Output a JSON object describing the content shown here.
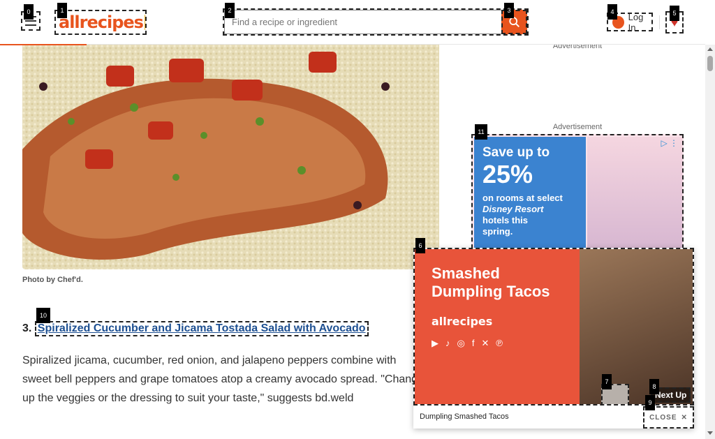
{
  "header": {
    "logo_text": "allrecipes",
    "search_placeholder": "Find a recipe or ingredient",
    "login_label": "Log In",
    "advertisement_top": "Advertisement",
    "scroll_progress_fraction": 0.12
  },
  "main": {
    "photo_caption": "Photo by Chef'd.",
    "recipe_number": "3.",
    "recipe_title": "Spiralized Cucumber and Jicama Tostada Salad with Avocado",
    "recipe_description": "Spiralized jicama, cucumber, red onion, and jalapeno peppers combine with sweet bell peppers and grape tomatoes atop a creamy avocado spread. \"Change up the veggies or the dressing to suit your taste,\" suggests bd.weld"
  },
  "rail": {
    "advertisement_label": "Advertisement",
    "ad": {
      "line1": "Save up to",
      "percent": "25%",
      "line2": "on rooms at select",
      "line3": "Disney Resort",
      "line4": "hotels this",
      "line5": "spring."
    }
  },
  "video": {
    "title_line1": "Smashed",
    "title_line2": "Dumpling Tacos",
    "brand": "allrecipes",
    "caption": "Dumpling Smashed Tacos",
    "next_up": "Next Up",
    "close_label": "CLOSE",
    "social_icons": [
      "youtube-icon",
      "tiktok-icon",
      "instagram-icon",
      "facebook-icon",
      "x-icon",
      "pinterest-icon"
    ]
  },
  "badges": [
    "0",
    "1",
    "2",
    "3",
    "4",
    "5",
    "6",
    "7",
    "8",
    "9",
    "10",
    "11"
  ],
  "colors": {
    "brand": "#e8541e",
    "link": "#1d4f91",
    "video_bg": "#e8543a"
  }
}
